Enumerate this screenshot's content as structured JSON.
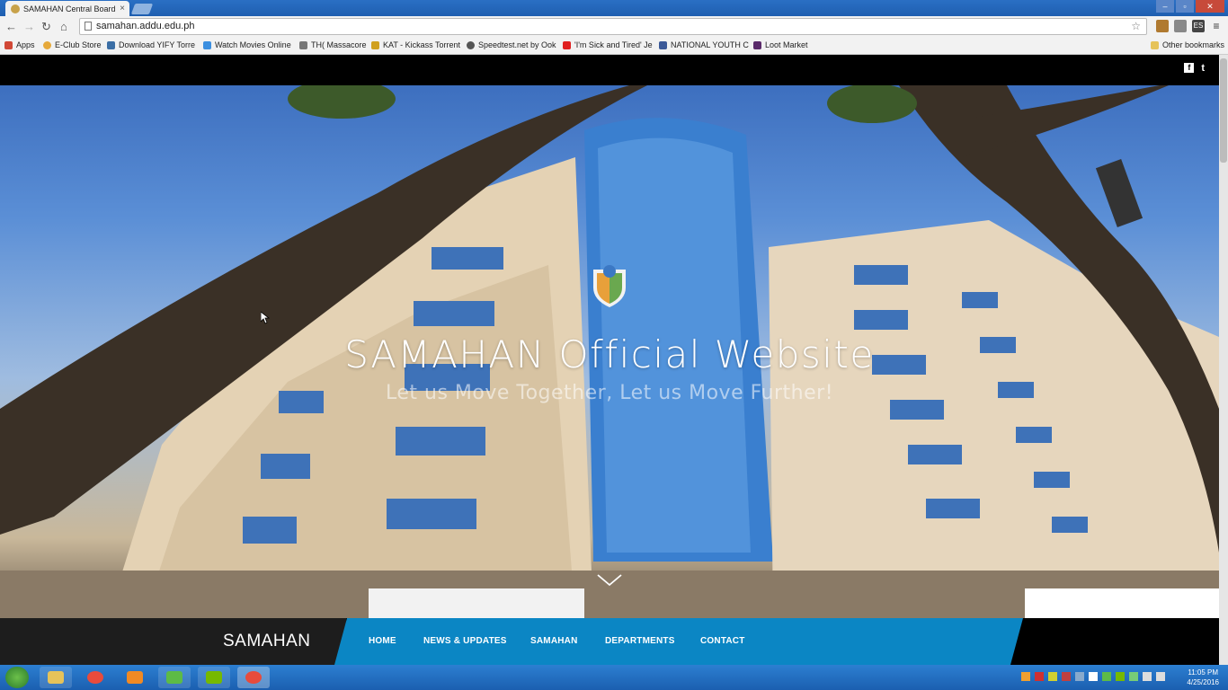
{
  "browser": {
    "tab_title": "SAMAHAN Central Board",
    "url": "samahan.addu.edu.ph",
    "bookmarks": [
      {
        "label": "Apps",
        "color": "#d14836"
      },
      {
        "label": "E-Club Store",
        "color": "#e6a93a"
      },
      {
        "label": "Download YIFY Torre",
        "color": "#3b6ea5"
      },
      {
        "label": "Watch Movies Online",
        "color": "#3b8fe0"
      },
      {
        "label": "TH( Massacore",
        "color": "#777777"
      },
      {
        "label": "KAT - Kickass Torrent",
        "color": "#d0a020"
      },
      {
        "label": "Speedtest.net by Ook",
        "color": "#555555"
      },
      {
        "label": "'I'm Sick and Tired' Je",
        "color": "#e02020"
      },
      {
        "label": "NATIONAL YOUTH C",
        "color": "#3b5998"
      },
      {
        "label": "Loot Market",
        "color": "#5a2a6a"
      }
    ],
    "other_bookmarks": "Other bookmarks"
  },
  "site": {
    "hero_title": "SAMAHAN Official Website",
    "hero_subtitle": "Let us Move Together, Let us Move Further!",
    "brand": "SAMAHAN",
    "nav": [
      "HOME",
      "NEWS & UPDATES",
      "SAMAHAN",
      "DEPARTMENTS",
      "CONTACT"
    ],
    "social": {
      "facebook": "f",
      "twitter": "t"
    }
  },
  "taskbar": {
    "time": "11:05 PM",
    "date": "4/25/2016"
  },
  "colors": {
    "nav_blue": "#0b86c4",
    "browser_blue": "#1f5fb0"
  },
  "icons": {
    "logo": "shield-logo-icon",
    "scroll": "chevron-down-icon"
  }
}
